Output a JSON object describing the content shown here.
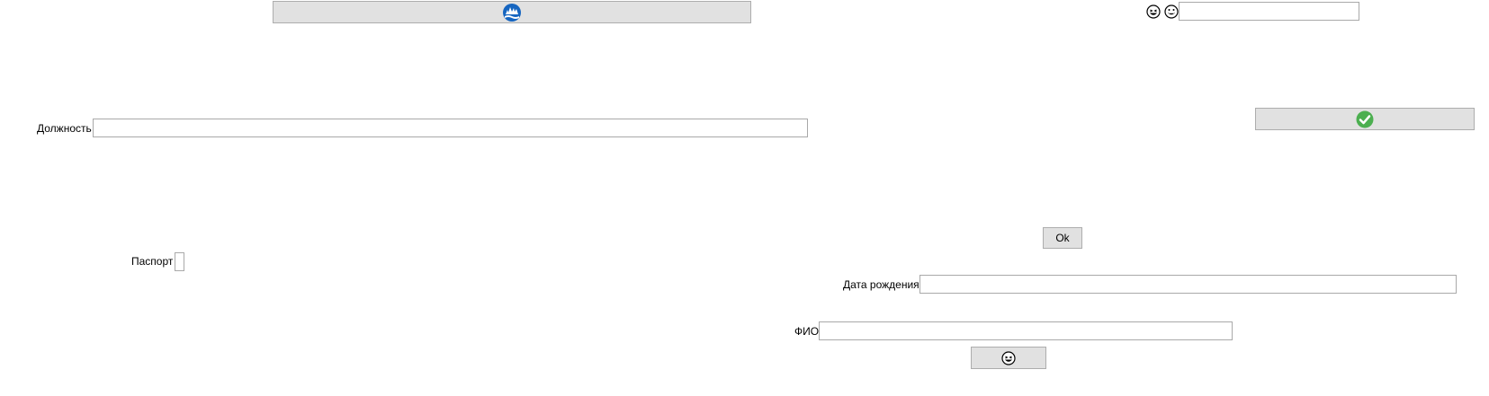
{
  "form": {
    "position_label": "Должность",
    "passport_label": "Паспорт",
    "birth_date_label": "Дата рождения",
    "full_name_label": "ФИО",
    "ok_label": "Ok",
    "position_value": "",
    "birth_date_value": "",
    "full_name_value": "",
    "top_right_value": ""
  },
  "icons": {
    "top_button": "globe-water-icon",
    "check_button": "check-icon",
    "emoji_left": "smile-squint-icon",
    "emoji_right": "grin-icon",
    "bottom_button": "laugh-icon"
  },
  "colors": {
    "button_bg": "#e1e1e1",
    "button_border": "#adadad",
    "field_border": "#a9a9a9",
    "globe_blue": "#1565c0",
    "check_green": "#4caf50"
  }
}
